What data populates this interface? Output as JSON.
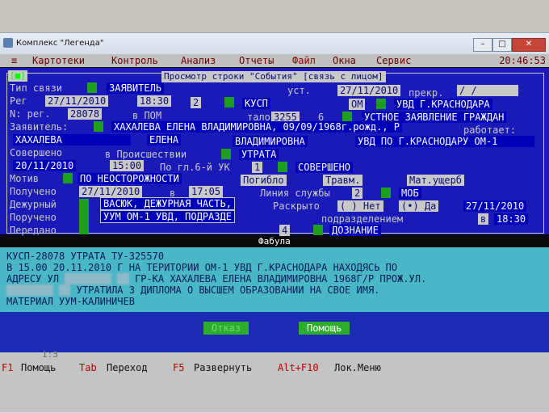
{
  "window": {
    "title": "Комплекс \"Легенда\""
  },
  "menu": {
    "items": [
      "Картотеки",
      "Контроль",
      "Анализ",
      "Отчеты",
      "Файл",
      "Окна",
      "Сервис"
    ],
    "clock": "20:46:53"
  },
  "form": {
    "title": "Просмотр строки \"События\" [связь с лицом]",
    "corner": "[■]",
    "labels": {
      "svyaz": "Тип связи",
      "reg": "Рег",
      "nreg": "N: рег.",
      "zayav": "Заявитель:",
      "soversheno": "Совершено",
      "motiv": "Мотив",
      "polucheno": "Получено",
      "dezhurny": "Дежурный",
      "porucheno": "Поручено",
      "peredano": "Передано",
      "ust": "уст.",
      "prekr": "прекр.",
      "talon": "талон",
      "rabotaet": "работает:",
      "vproish": "в Происшествии",
      "pogl": "По гл.6-й УК",
      "pogiblo": "Погибло",
      "travm": "Травм.",
      "mat": "Мат.ущерб",
      "v": "в",
      "liniya": "Линия службы",
      "raskryto": "Раскрыто",
      "podraz": "подразделением",
      "v2": "в"
    },
    "values": {
      "svyaz": "ЗАЯВИТЕЛЬ",
      "ust_date": "27/11/2010",
      "prekr_date": "/  /",
      "reg_date": "27/11/2010",
      "reg_time": "18:30",
      "reg_num": "2",
      "kusp": "КУСП",
      "om": "ОМ",
      "uvd": "УВД Г.КРАСНОДАРА",
      "nreg": "28078",
      "vpom": "в ПОМ",
      "talon": "3255",
      "talon_n": "6",
      "ustnoe": "УСТНОЕ ЗАЯВЛЕНИЕ ГРАЖДАН",
      "zayav": "ХАХАЛЕВА ЕЛЕНА ВЛАДИМИРОВНА, 09/09/1968г.рожд., Р",
      "fam": "ХАХАЛЕВА",
      "imya": "ЕЛЕНА",
      "otch": "ВЛАДИМИРОВНА",
      "rabota": "УВД ПО Г.КРАСНОДАРУ ОМ-1",
      "utrata": "УТРАТА",
      "sov_date": "20/11/2010",
      "sov_time": "15:00",
      "pogl": "1",
      "sov_st": "СОВЕРШЕНО",
      "motiv": "ПО НЕОСТОРОЖНОСТИ",
      "pol_date": "27/11/2010",
      "pol_time": "17:05",
      "liniya": "2",
      "mob": "МОБ",
      "dezh1": "ВАСЮК, ДЕЖУРНАЯ ЧАСТЬ,",
      "dezh2": "УУМ ОМ-1 УВД, ПОДРАЗДЕ",
      "net": "( ) Нет",
      "da": "(•) Да",
      "rask_date": "27/11/2010",
      "rask_time": "18:30",
      "pered_n": "4",
      "doznanie": "ДОЗНАНИЕ"
    }
  },
  "fabula": {
    "label": "Фабула",
    "lines": [
      "КУСП-28078 УТРАТА ТУ-325570",
      "В 15.00 20.11.2010 Г НА ТЕРИТОРИИ ОМ-1 УВД Г.КРАСНОДАРА НАХОДЯСЬ ПО",
      "АДРЕСУ УЛ",
      "ГР-КА ХАХАЛЕВА ЕЛЕНА ВЛАДИМИРОВНА 1968Г/Р ПРОЖ.УЛ.",
      "УТРАТИЛА 3 ДИПЛОМА О ВЫСШЕМ ОБРАЗОВАНИИ НА СВОЕ ИМЯ.",
      "МАТЕРИАЛ УУМ-КАЛИНИЧЕВ"
    ]
  },
  "buttons": {
    "cancel": "Отказ",
    "help": "Помощь"
  },
  "status": {
    "page": "1:3",
    "keys": [
      {
        "k": "F1",
        "d": "Помощь"
      },
      {
        "k": "Tab",
        "d": "Переход"
      },
      {
        "k": "F5",
        "d": "Развернуть"
      },
      {
        "k": "Alt+F10",
        "d": "Лок.Меню"
      }
    ]
  }
}
